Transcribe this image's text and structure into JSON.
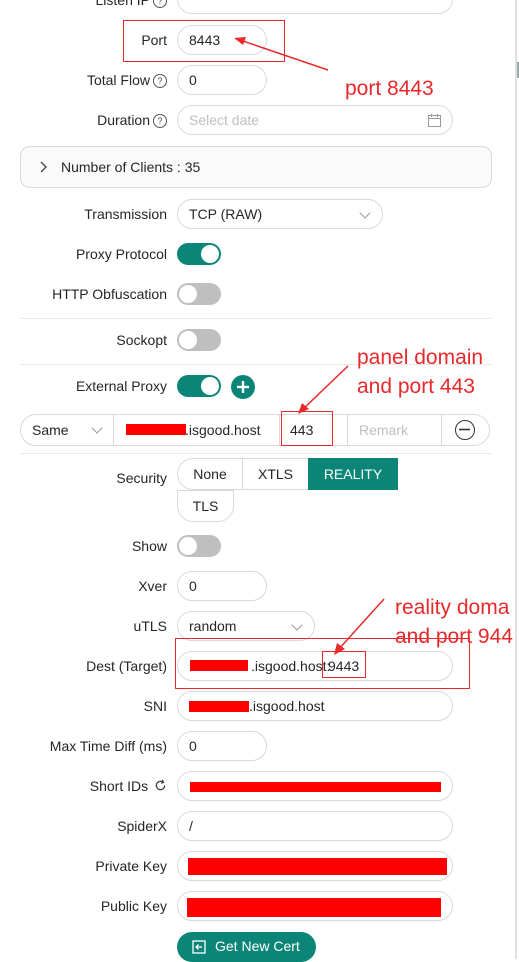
{
  "form": {
    "listen_ip_label": "Listen IP",
    "port_label": "Port",
    "port_value": "8443",
    "total_flow_label": "Total Flow",
    "total_flow_value": "0",
    "duration_label": "Duration",
    "duration_placeholder": "Select date",
    "clients_collapse": "Number of Clients : 35",
    "transmission_label": "Transmission",
    "transmission_value": "TCP (RAW)",
    "proxy_protocol_label": "Proxy Protocol",
    "proxy_protocol_on": true,
    "http_obfuscation_label": "HTTP Obfuscation",
    "http_obfuscation_on": false,
    "sockopt_label": "Sockopt",
    "sockopt_on": false,
    "external_proxy_label": "External Proxy",
    "external_proxy_on": true,
    "external_proxy_row": {
      "mode": "Same",
      "domain_suffix": ".isgood.host",
      "port": "443",
      "remark_placeholder": "Remark"
    },
    "security_label": "Security",
    "security_options": [
      "None",
      "XTLS",
      "REALITY",
      "TLS"
    ],
    "security_selected": "REALITY",
    "show_label": "Show",
    "show_on": false,
    "xver_label": "Xver",
    "xver_value": "0",
    "utls_label": "uTLS",
    "utls_value": "random",
    "dest_label": "Dest (Target)",
    "dest_suffix": ".isgood.host:",
    "dest_port": "9443",
    "sni_label": "SNI",
    "sni_suffix": ".isgood.host",
    "max_time_diff_label": "Max Time Diff (ms)",
    "max_time_diff_value": "0",
    "short_ids_label": "Short IDs",
    "spiderx_label": "SpiderX",
    "spiderx_value": "/",
    "private_key_label": "Private Key",
    "public_key_label": "Public Key",
    "get_new_cert_label": "Get New Cert"
  },
  "annotations": {
    "port_note": "port 8443",
    "panel_note_line1": "panel domain",
    "panel_note_line2": "and port 443",
    "reality_note_line1": "reality doma",
    "reality_note_line2": "and port 944"
  },
  "colors": {
    "accent": "#0b8577",
    "annotation_red": "#e8292a",
    "redaction": "#ff0000"
  }
}
